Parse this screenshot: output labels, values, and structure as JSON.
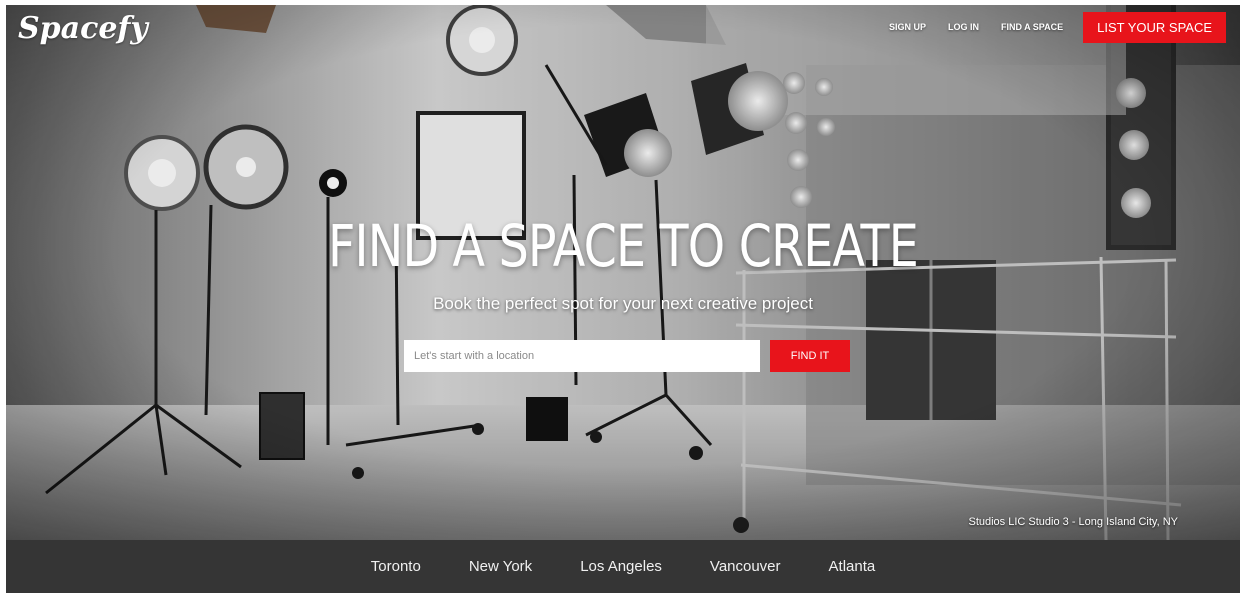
{
  "brand": {
    "logo_text": "Spacefy"
  },
  "nav": {
    "items": [
      {
        "label": "SIGN UP"
      },
      {
        "label": "LOG IN"
      },
      {
        "label": "FIND A SPACE"
      }
    ],
    "cta_label": "LIST YOUR SPACE"
  },
  "hero": {
    "headline": "FIND A SPACE TO CREATE",
    "subline": "Book the perfect spot for your next creative project",
    "search_placeholder": "Let's start with a location",
    "search_button": "FIND IT",
    "photo_caption": "Studios LIC Studio 3 - Long Island City, NY"
  },
  "cities": [
    {
      "label": "Toronto"
    },
    {
      "label": "New York"
    },
    {
      "label": "Los Angeles"
    },
    {
      "label": "Vancouver"
    },
    {
      "label": "Atlanta"
    }
  ],
  "colors": {
    "accent": "#e8141b",
    "city_bar": "#353535"
  },
  "icons": [
    "studio-photo-illustration"
  ]
}
